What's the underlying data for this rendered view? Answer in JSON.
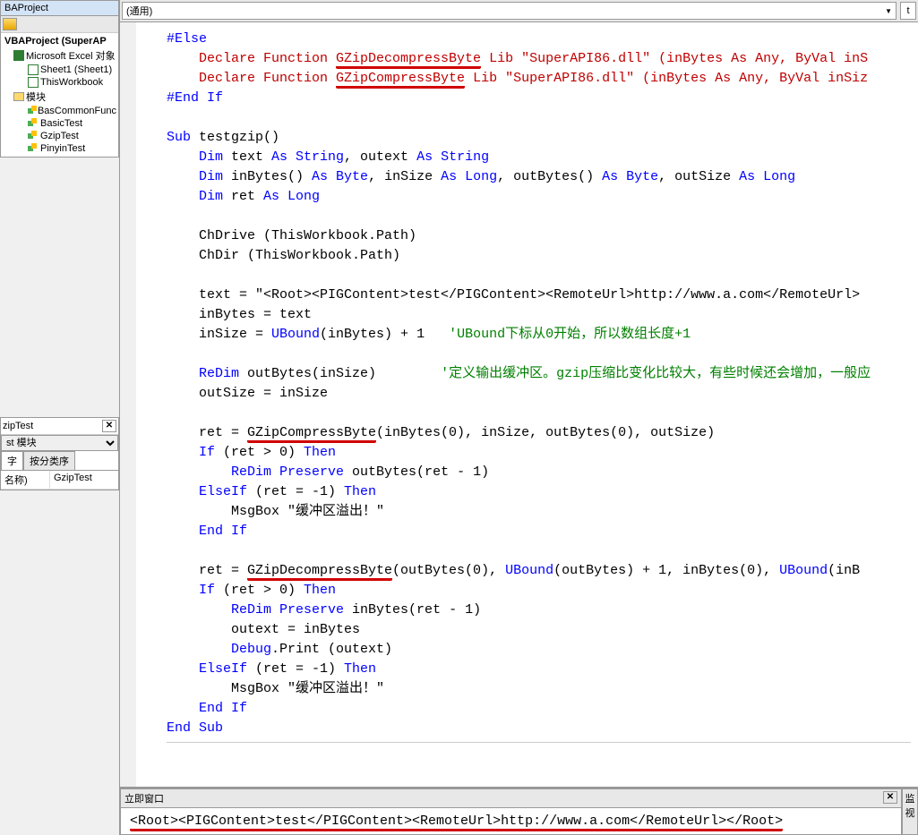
{
  "project_panel": {
    "title": "BAProject",
    "root": "VBAProject (SuperAP",
    "excel_node": "Microsoft Excel 对象",
    "sheet1": "Sheet1 (Sheet1)",
    "thiswb": "ThisWorkbook",
    "modules_label": "模块",
    "modules": [
      "BasCommonFunc",
      "BasicTest",
      "GzipTest",
      "PinyinTest"
    ]
  },
  "props": {
    "title": "zipTest",
    "combo_value": "st 模块",
    "tab1": "字",
    "tab2": "按分类序",
    "name_label": "名称)",
    "name_value": "GzipTest"
  },
  "code_header": {
    "left_combo": "(通用)",
    "right_combo": "t"
  },
  "code": {
    "l1": "#Else",
    "l2a": "    Declare Function ",
    "l2b": "GZipDecompressByte",
    "l2c": " Lib \"SuperAPI86.dll\" (inBytes As Any, ByVal inS",
    "l3a": "    Declare Function ",
    "l3b": "GZipCompressByte",
    "l3c": " Lib \"SuperAPI86.dll\" (inBytes As Any, ByVal inSiz",
    "l4": "#End If",
    "l6a": "Sub",
    "l6b": " testgzip()",
    "l7a": "    Dim",
    "l7b": " text ",
    "l7c": "As String",
    "l7d": ", outext ",
    "l7e": "As String",
    "l8a": "    Dim",
    "l8b": " inBytes() ",
    "l8c": "As Byte",
    "l8d": ", inSize ",
    "l8e": "As Long",
    "l8f": ", outBytes() ",
    "l8g": "As Byte",
    "l8h": ", outSize ",
    "l8i": "As Long",
    "l9a": "    Dim",
    "l9b": " ret ",
    "l9c": "As Long",
    "l11": "    ChDrive (ThisWorkbook.Path)",
    "l12": "    ChDir (ThisWorkbook.Path)",
    "l14": "    text = \"<Root><PIGContent>test</PIGContent><RemoteUrl>http://www.a.com</RemoteUrl>",
    "l15": "    inBytes = text",
    "l16a": "    inSize = ",
    "l16b": "UBound",
    "l16c": "(inBytes) + 1   ",
    "l16d": "'UBound下标从0开始，所以数组长度+1",
    "l18a": "    ReDim",
    "l18b": " outBytes(inSize)        ",
    "l18c": "'定义输出缓冲区。gzip压缩比变化比较大，有些时候还会增加，一般应",
    "l19": "    outSize = inSize",
    "l21a": "    ret = ",
    "l21b": "GZipCompressByte",
    "l21c": "(inBytes(0), inSize, outBytes(0), outSize)",
    "l22a": "    If",
    "l22b": " (ret > 0) ",
    "l22c": "Then",
    "l23a": "        ReDim Preserve",
    "l23b": " outBytes(ret - 1)",
    "l24a": "    ElseIf",
    "l24b": " (ret = -1) ",
    "l24c": "Then",
    "l25": "        MsgBox \"缓冲区溢出！\"",
    "l26": "    End If",
    "l28a": "    ret = ",
    "l28b": "GZipDecompressByte",
    "l28c": "(outBytes(0), ",
    "l28d": "UBound",
    "l28e": "(outBytes) + 1, inBytes(0), ",
    "l28f": "UBound",
    "l28g": "(inB",
    "l29a": "    If",
    "l29b": " (ret > 0) ",
    "l29c": "Then",
    "l30a": "        ReDim Preserve",
    "l30b": " inBytes(ret - 1)",
    "l31": "        outext = inBytes",
    "l32a": "        Debug",
    "l32b": ".Print (outext)",
    "l33a": "    ElseIf",
    "l33b": " (ret = -1) ",
    "l33c": "Then",
    "l34": "        MsgBox \"缓冲区溢出！\"",
    "l35": "    End If",
    "l36": "End Sub"
  },
  "immediate": {
    "title": "立即窗口",
    "output": "<Root><PIGContent>test</PIGContent><RemoteUrl>http://www.a.com</RemoteUrl></Root>"
  },
  "watch_stub": "监视"
}
